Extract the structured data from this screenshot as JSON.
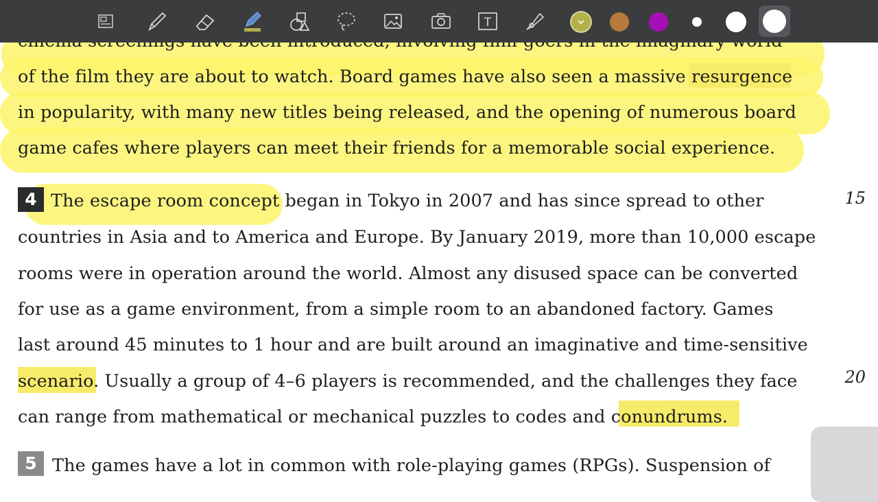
{
  "toolbar": {
    "tools": [
      {
        "icon": "layout-icon"
      },
      {
        "icon": "pen-icon"
      },
      {
        "icon": "eraser-icon"
      },
      {
        "icon": "highlighter-icon"
      },
      {
        "icon": "shapes-icon"
      },
      {
        "icon": "lasso-icon"
      },
      {
        "icon": "image-icon"
      },
      {
        "icon": "camera-icon"
      },
      {
        "icon": "text-icon"
      },
      {
        "icon": "laser-pointer-icon"
      }
    ],
    "colors": [
      "#b4b04a",
      "#b77a3a",
      "#a60fb8"
    ],
    "text_tool_label": "T"
  },
  "document": {
    "lines": [
      "cinema screenings have been introduced, involving film-goers in the imaginary world",
      "of the film they are about to watch. Board games have also seen a massive resurgence",
      "in popularity, with many new titles being released, and the opening of numerous board",
      "game cafes where players can meet their friends for a memorable social experience.",
      "The escape room concept began in Tokyo in 2007 and has since spread to other",
      "countries in Asia and to America and Europe. By January 2019, more than 10,000 escape",
      "rooms were in operation around the world. Almost any disused space can be converted",
      "for use as a game environment, from a simple room to an abandoned factory. Games",
      "last around 45 minutes to 1 hour and are built around an imaginative and time-sensitive",
      "scenario. Usually a group of 4–6 players is recommended, and the challenges they face",
      "can range from mathematical or mechanical puzzles to codes and conundrums.",
      "The games have a lot in common with role-playing games (RPGs). Suspension of"
    ],
    "paragraph_numbers": [
      "4",
      "5"
    ],
    "line_numbers": [
      "15",
      "20"
    ]
  }
}
